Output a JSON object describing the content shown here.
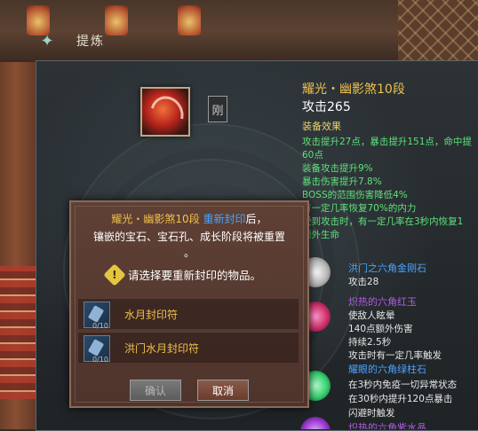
{
  "window": {
    "title": "提炼"
  },
  "item": {
    "side_glyph": "刚"
  },
  "tooltip": {
    "name": "耀光・幽影煞10段",
    "attack": "攻击265",
    "effects_header": "装备效果",
    "effects": [
      "攻击提升27点，暴击提升151点，命中提",
      "60点",
      "装备攻击提升9%",
      "暴击伤害提升7.8%",
      "BOSS的范围伤害降低4%",
      "有一定几率恢复70%的内力",
      "受到攻击时，有一定几率在3秒内恢复1",
      "额外生命"
    ],
    "gems": [
      {
        "title": "洪门之六角金刚石",
        "title_color": "#4aa3ff",
        "desc": [
          "攻击28"
        ],
        "gem_color": "#d8d8d8"
      },
      {
        "title": "炽热的六角红玉",
        "title_color": "#b05de0",
        "desc": [
          "使敌人眩晕",
          "140点额外伤害",
          "持续2.5秒",
          "攻击时有一定几率触发"
        ],
        "gem_color": "#d0306a"
      },
      {
        "title": "耀眼的六角绿柱石",
        "title_color": "#4aa3ff",
        "desc": [
          "在3秒内免疫一切异常状态",
          "在30秒内提升120点暴击",
          "闪避时触发"
        ],
        "gem_color": "#38d070"
      },
      {
        "title": "炽热的六角紫水晶",
        "title_color": "#b05de0",
        "desc": [],
        "gem_color": "#9a3ad0"
      }
    ]
  },
  "dialog": {
    "msg_item": "耀光・幽影煞10段",
    "msg_action": "重新封印",
    "msg_after": "后，",
    "msg_line2": "镶嵌的宝石、宝石孔、成长阶段将被重置",
    "msg_line3": "。",
    "hint": "请选择要重新封印的物品。",
    "options": [
      {
        "count": "0/10",
        "label": "水月封印符"
      },
      {
        "count": "0/10",
        "label": "洪门水月封印符"
      }
    ],
    "ok_label": "确认",
    "cancel_label": "取消"
  },
  "colors": {
    "gold": "#f0c14b",
    "blue": "#4aa3ff",
    "green": "#5ee27a",
    "purple": "#b05de0"
  }
}
